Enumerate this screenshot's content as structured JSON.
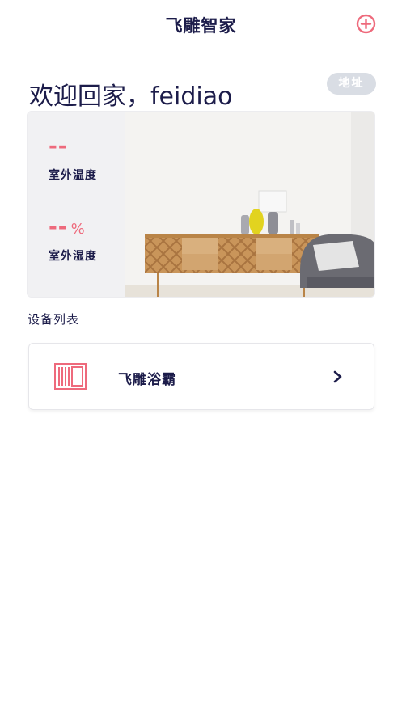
{
  "nav": {
    "title": "飞雕智家",
    "add_icon": "plus-circle-icon"
  },
  "welcome": {
    "text": "欢迎回家，feidiao"
  },
  "address_button": {
    "label": "地址"
  },
  "weather": {
    "temperature": {
      "value": "--",
      "label": "室外温度"
    },
    "humidity": {
      "value": "--",
      "unit": "%",
      "label": "室外湿度"
    }
  },
  "devices": {
    "section_title": "设备列表",
    "items": [
      {
        "name": "飞雕浴霸",
        "icon": "bath-heater-icon"
      }
    ]
  },
  "colors": {
    "accent": "#ee6a7c",
    "text": "#1c1c4a",
    "badge": "#d9dde4"
  }
}
